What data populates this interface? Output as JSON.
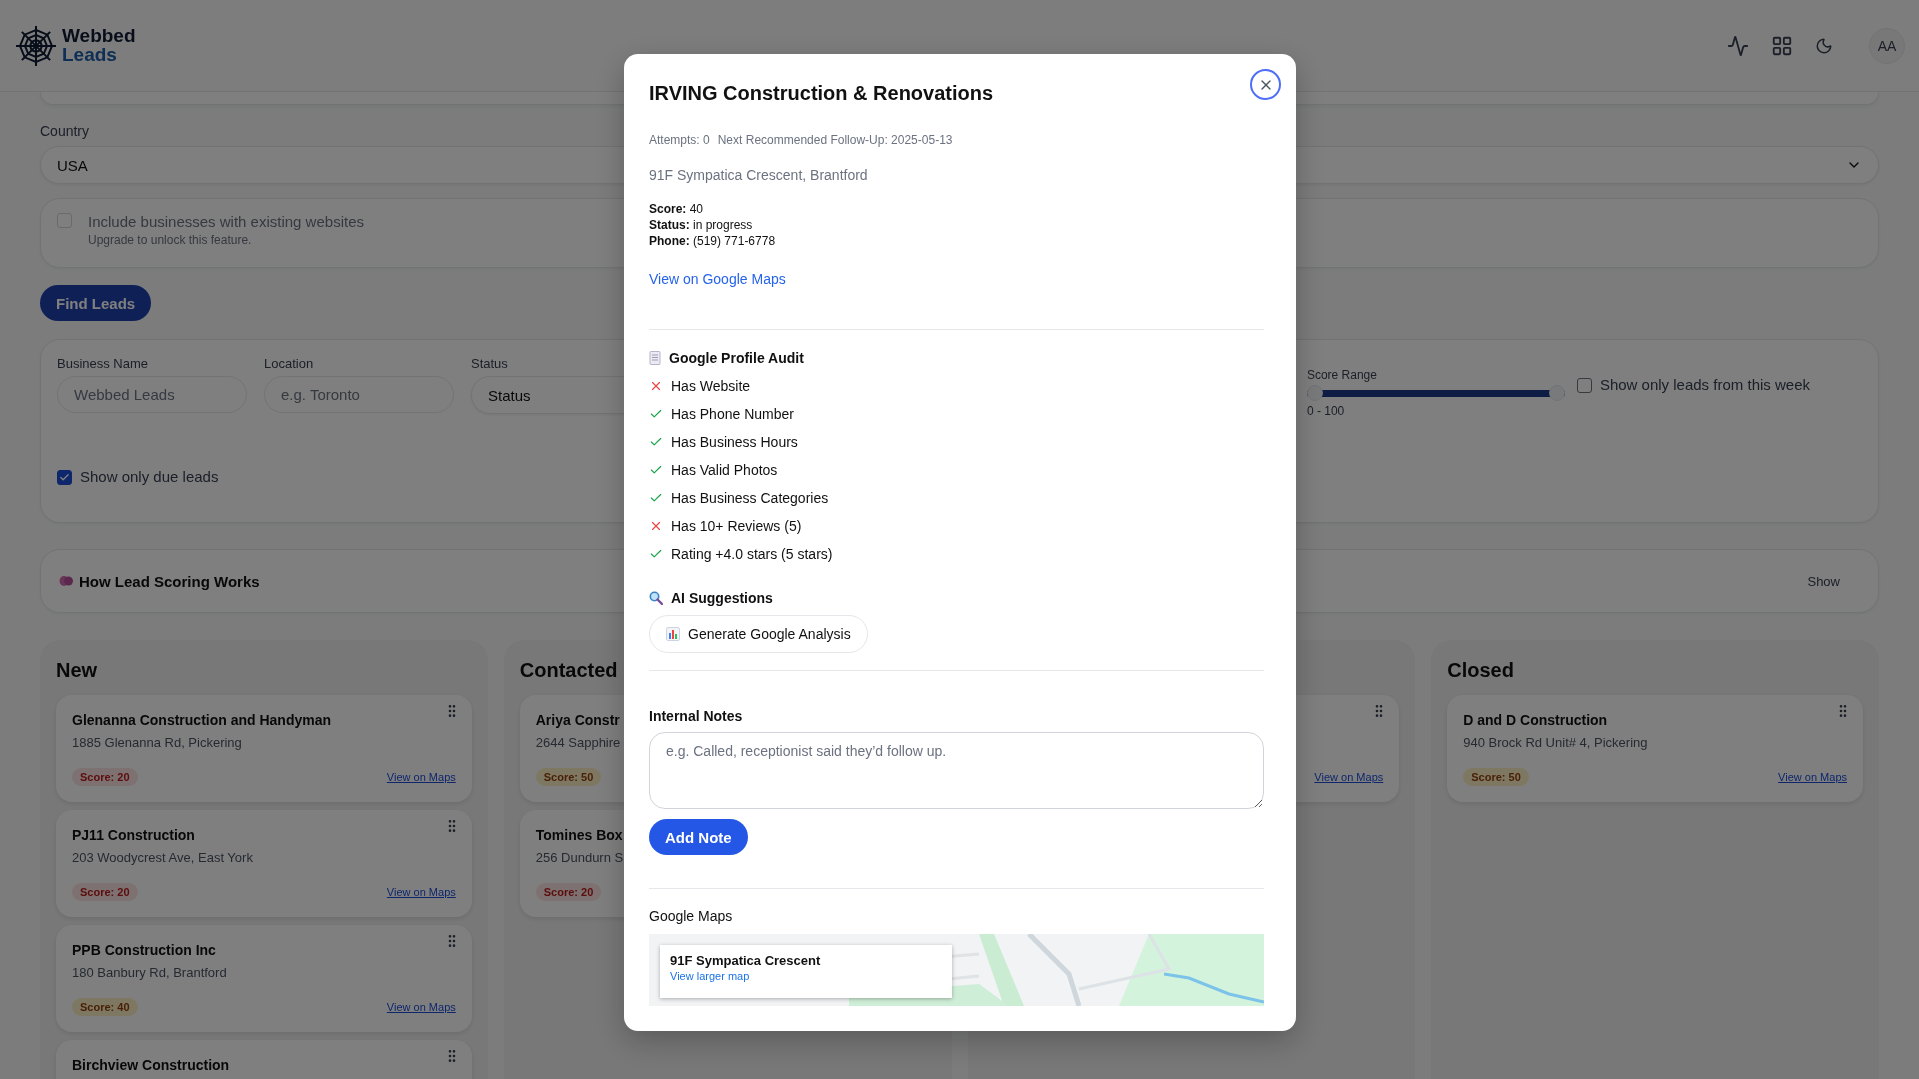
{
  "header": {
    "logo": {
      "line_1": "Webbed",
      "line_2": "Leads"
    },
    "avatar": "AA"
  },
  "search_form": {
    "country": {
      "label": "Country",
      "value": "USA"
    },
    "website_option": {
      "label": "Include businesses with existing websites",
      "note": "Upgrade to unlock this feature.",
      "checked": false,
      "disabled": true
    },
    "find_button": "Find Leads"
  },
  "filters": {
    "business_name": {
      "label": "Business Name",
      "placeholder": "Webbed Leads"
    },
    "location": {
      "label": "Location",
      "placeholder": "e.g. Toronto"
    },
    "status": {
      "label": "Status",
      "value": "Status"
    },
    "score_range": {
      "label": "Score Range",
      "level": 1,
      "reading": "0 - 100"
    },
    "week_option": {
      "label": "Show only leads from this week",
      "checked": false
    },
    "due_option": {
      "label": "Show only due leads",
      "checked": true
    }
  },
  "scoring_panel": {
    "title": "How Lead Scoring Works",
    "toggle": "Show"
  },
  "board": {
    "columns": [
      {
        "title": "New",
        "cards": [
          {
            "name": "Glenanna Construction and Handyman",
            "address": "1885 Glenanna Rd, Pickering",
            "score": "Score: 20",
            "kind": "low",
            "link": "View on Maps"
          },
          {
            "name": "PJ11 Construction",
            "address": "203 Woodycrest Ave, East York",
            "score": "Score: 20",
            "kind": "low",
            "link": "View on Maps"
          },
          {
            "name": "PPB Construction Inc",
            "address": "180 Banbury Rd, Brantford",
            "score": "Score: 40",
            "kind": "medium",
            "link": "View on Maps"
          },
          {
            "name": "Birchview Construction"
          }
        ]
      },
      {
        "title": "Contacted",
        "cards": [
          {
            "name": "Ariya Constr",
            "address": "2644 Sapphire",
            "score": "Score: 50",
            "kind": "medium"
          },
          {
            "name": "Tomines Box",
            "address": "256 Dundurn S",
            "score": "Score: 20",
            "kind": "low"
          }
        ]
      },
      {
        "cards": [
          {
            "link": "View on Maps"
          }
        ]
      },
      {
        "title": "Closed",
        "cards": [
          {
            "name": "D and D Construction",
            "address": "940 Brock Rd Unit# 4, Pickering",
            "score": "Score: 50",
            "kind": "medium",
            "link": "View on Maps"
          }
        ]
      }
    ]
  },
  "lead_dialog": {
    "title": "IRVING Construction & Renovations",
    "attempts": "Attempts: 0",
    "follow_up": "Next Recommended Follow-Up: 2025-05-13",
    "address": "91F Sympatica Crescent, Brantford",
    "facts": [
      "**Score:** 40",
      "**Status:** in progress",
      "**Phone:** (519) 771-6778"
    ],
    "maps_link": "View on Google Maps",
    "audit": {
      "title": "Google Profile Audit",
      "items": [
        {
          "label": "Has Website",
          "passed": false
        },
        {
          "label": "Has Phone Number",
          "passed": true
        },
        {
          "label": "Has Business Hours",
          "passed": true
        },
        {
          "label": "Has Valid Photos",
          "passed": true
        },
        {
          "label": "Has Business Categories",
          "passed": true
        },
        {
          "label": "Has 10+ Reviews (5)",
          "passed": false
        },
        {
          "label": "Rating +4.0 stars (5 stars)",
          "passed": true
        }
      ]
    },
    "ai": {
      "title": "AI Suggestions",
      "button": "Generate Google Analysis"
    },
    "notes": {
      "title": "Internal Notes",
      "placeholder": "e.g. Called, receptionist said they’d follow up.",
      "button": "Add Note"
    },
    "map": {
      "title": "Google Maps",
      "place": "91F Sympatica Crescent",
      "link": "View larger map",
      "kind": "picture"
    }
  }
}
